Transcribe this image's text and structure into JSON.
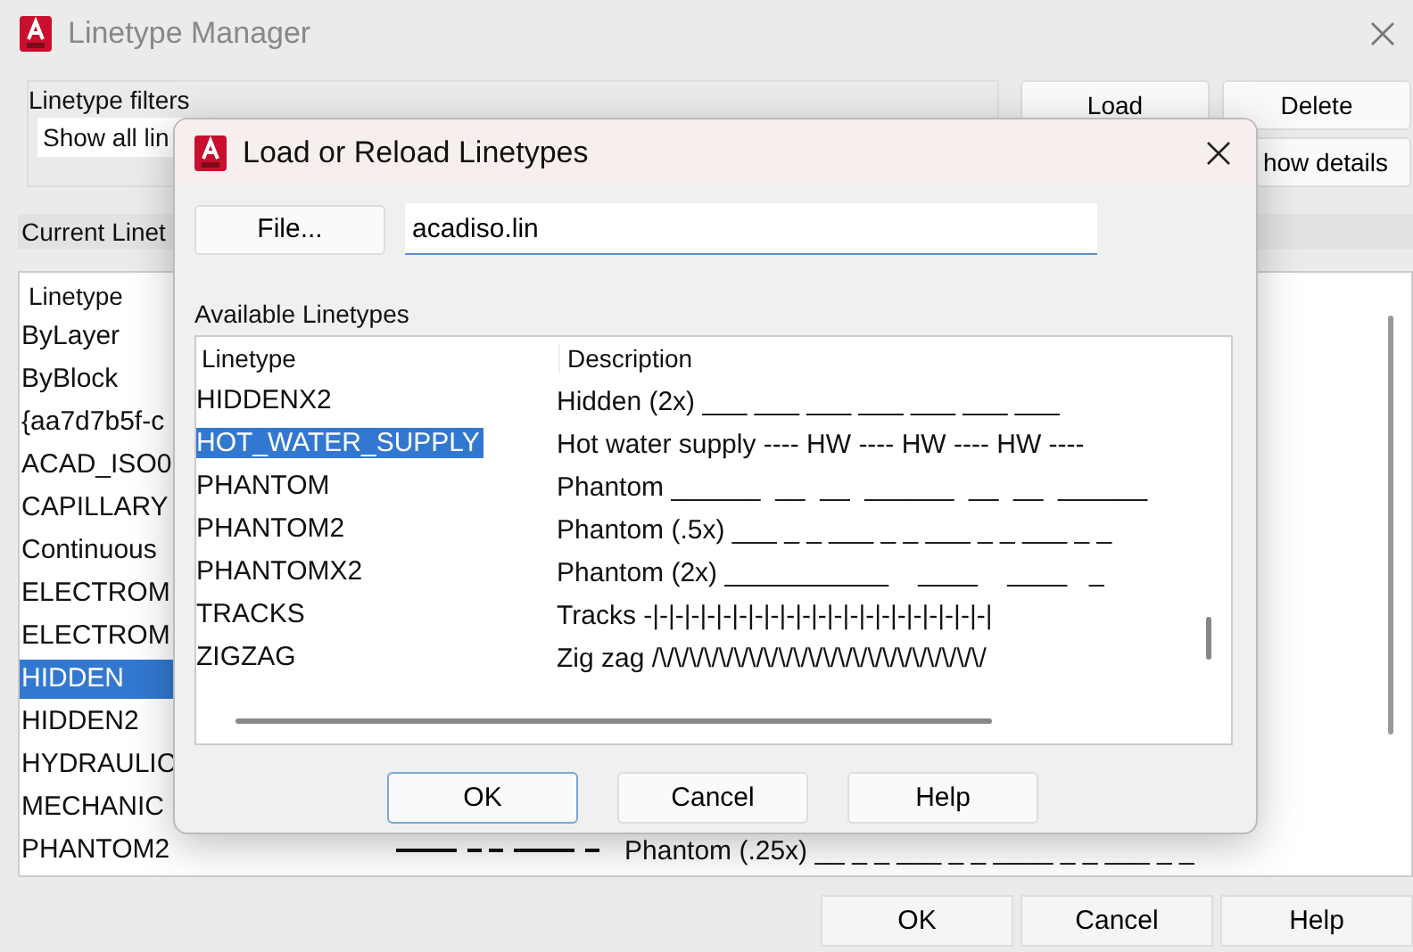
{
  "main_window": {
    "title": "Linetype Manager",
    "filter_label": "Linetype filters",
    "filter_value": "Show all lin",
    "buttons": [
      "Load",
      "Delete",
      "how details"
    ],
    "current_label": "Current Linet",
    "list": {
      "column": "Linetype",
      "rows": [
        {
          "linetype": "ByLayer",
          "selected": false
        },
        {
          "linetype": "ByBlock",
          "selected": false
        },
        {
          "linetype": "{aa7d7b5f-c",
          "selected": false
        },
        {
          "linetype": "ACAD_ISO0",
          "selected": false
        },
        {
          "linetype": "CAPILLARY",
          "selected": false
        },
        {
          "linetype": "Continuous",
          "selected": false
        },
        {
          "linetype": "ELECTROM",
          "selected": false
        },
        {
          "linetype": "ELECTROM",
          "selected": false
        },
        {
          "linetype": "HIDDEN",
          "selected": true
        },
        {
          "linetype": "HIDDEN2",
          "selected": false
        },
        {
          "linetype": "HYDRAULIC",
          "selected": false
        },
        {
          "linetype": "MECHANIC",
          "selected": false
        },
        {
          "linetype": "PHANTOM2",
          "description": "Phantom (.25x) __ _ _ ___ _ _ ____ _ _ ___ _ _",
          "selected": false
        }
      ]
    },
    "footer_buttons": [
      "OK",
      "Cancel",
      "Help"
    ]
  },
  "dialog": {
    "title": "Load or Reload Linetypes",
    "file_button": "File...",
    "file_value": "acadiso.lin",
    "list_label": "Available Linetypes",
    "columns": [
      "Linetype",
      "Description"
    ],
    "rows": [
      {
        "linetype": "HIDDENX2",
        "description": "Hidden (2x) ___ ___ ___ ___ ___ ___ ___",
        "selected": false
      },
      {
        "linetype": "HOT_WATER_SUPPLY",
        "description": "Hot water supply ---- HW ---- HW ---- HW ----",
        "selected": true
      },
      {
        "linetype": "PHANTOM",
        "description": "Phantom ______  __  __  ______  __  __  ______",
        "selected": false
      },
      {
        "linetype": "PHANTOM2",
        "description": "Phantom (.5x) ___ _ _ ___ _ _ ___ _ _ ___ _ _",
        "selected": false
      },
      {
        "linetype": "PHANTOMX2",
        "description": "Phantom (2x) ___________    ____    ____   _",
        "selected": false
      },
      {
        "linetype": "TRACKS",
        "description": "Tracks -|-|-|-|-|-|-|-|-|-|-|-|-|-|-|-|-|-|-|-|-|-|",
        "selected": false
      },
      {
        "linetype": "ZIGZAG",
        "description": "Zig zag /\\/\\/\\/\\/\\/\\/\\/\\/\\/\\/\\/\\/\\/\\/\\/\\/\\/\\/\\/\\/\\/\\/",
        "selected": false
      }
    ],
    "buttons": [
      {
        "label": "OK",
        "selected": true
      },
      {
        "label": "Cancel",
        "selected": false
      },
      {
        "label": "Help",
        "selected": false
      }
    ]
  }
}
